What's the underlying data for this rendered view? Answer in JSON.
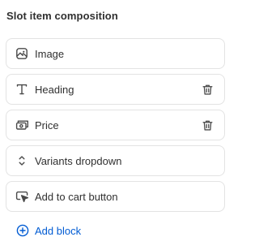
{
  "section": {
    "title": "Slot item composition"
  },
  "blocks": [
    {
      "label": "Image",
      "icon": "image-icon",
      "deletable": false
    },
    {
      "label": "Heading",
      "icon": "text-icon",
      "deletable": true
    },
    {
      "label": "Price",
      "icon": "price-icon",
      "deletable": true
    },
    {
      "label": "Variants dropdown",
      "icon": "select-icon",
      "deletable": false
    },
    {
      "label": "Add to cart button",
      "icon": "button-press-icon",
      "deletable": false
    }
  ],
  "add_block": {
    "label": "Add block",
    "icon": "plus-circle-icon"
  },
  "colors": {
    "text": "#303030",
    "border": "#e3e3e3",
    "accent": "#005bd3",
    "icon": "#4a4a4a"
  }
}
